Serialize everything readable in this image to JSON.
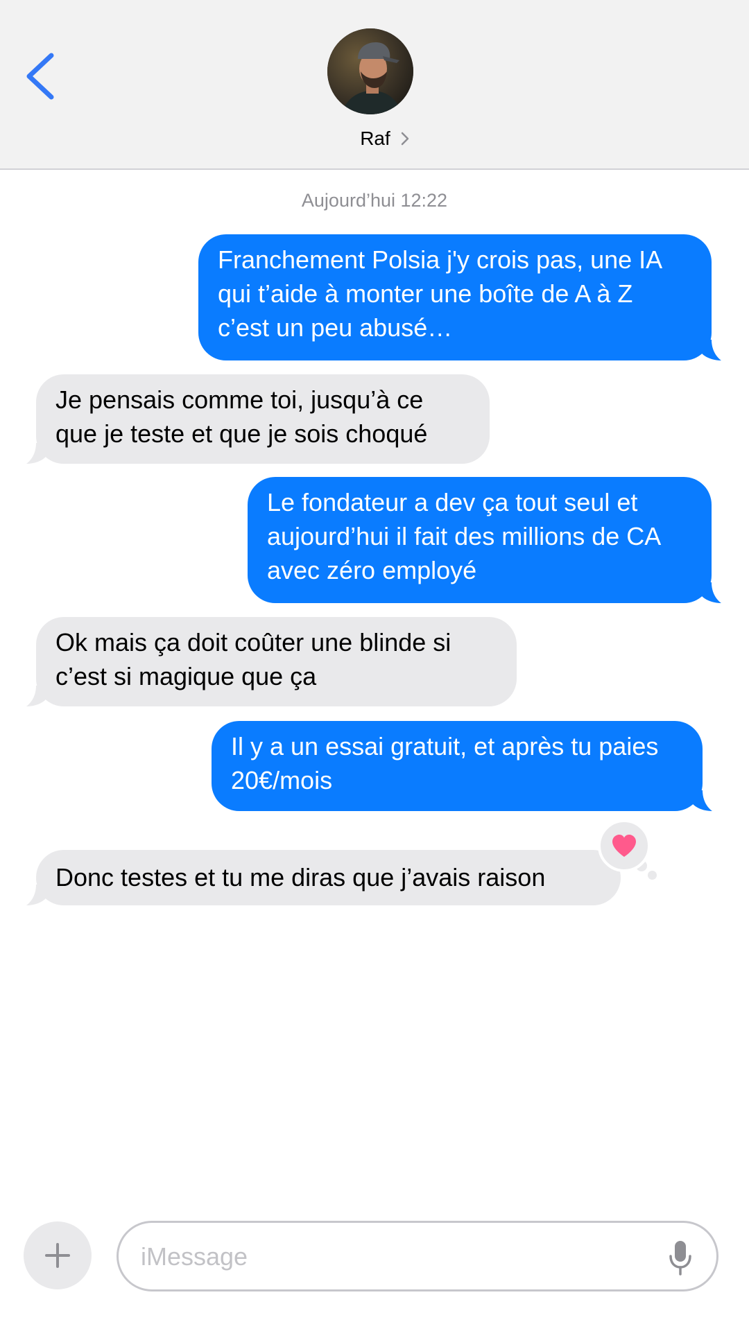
{
  "header": {
    "contact_name": "Raf",
    "icons": {
      "back": "chevron-left-icon",
      "contact_chevron": "chevron-right-icon",
      "avatar": "avatar-photo"
    }
  },
  "conversation": {
    "timestamp": "Aujourd’hui 12:22",
    "messages": [
      {
        "direction": "sent",
        "text": "Franchement Polsia j'y crois pas, une IA\nqui t’aide à monter une boîte de A à Z\nc’est un peu abusé…"
      },
      {
        "direction": "received",
        "text": "Je pensais comme toi, jusqu’à ce\nque je teste et que je sois choqué"
      },
      {
        "direction": "sent",
        "text": "Le fondateur a dev ça tout seul et\naujourd’hui il fait des millions de CA\navec zéro employé"
      },
      {
        "direction": "received",
        "text": "Ok mais ça doit coûter une blinde si\nc’est si magique que ça"
      },
      {
        "direction": "sent",
        "text": "Il y a un essai gratuit, et après tu paies\n20€/mois"
      },
      {
        "direction": "received",
        "text": "Donc testes et tu me diras que j’avais raison",
        "reaction": "heart-icon"
      }
    ]
  },
  "composer": {
    "placeholder": "iMessage",
    "value": "",
    "icons": {
      "add": "plus-icon",
      "mic": "microphone-icon"
    }
  },
  "colors": {
    "sent_bubble": "#0a7cff",
    "received_bubble": "#e9e9eb",
    "accent": "#3478f6",
    "reaction_heart": "#ff5a8c",
    "header_background": "#f2f2f2"
  }
}
